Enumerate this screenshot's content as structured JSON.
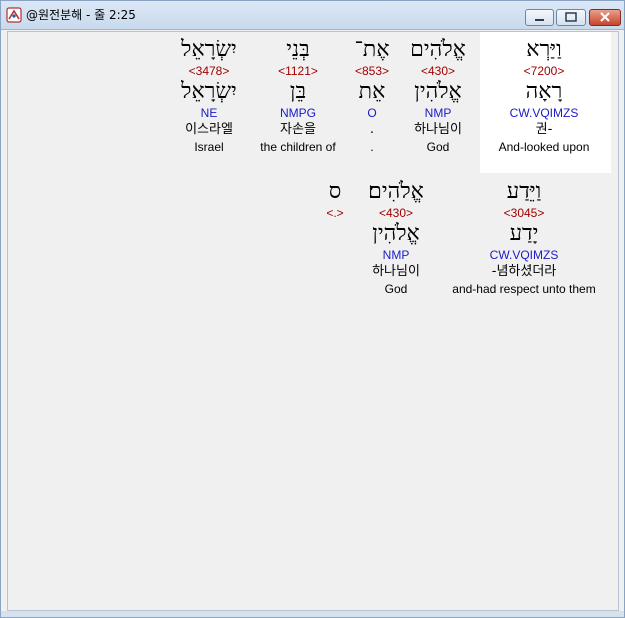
{
  "window": {
    "title": "@원전분해 - 줄 2:25"
  },
  "row1": [
    {
      "heb": "וַיַּרְא",
      "strong": "<7200>",
      "lemma": "רָאָה",
      "morph": "CW.VQIMZS",
      "kor": "권-",
      "eng": "And-looked upon"
    },
    {
      "heb": "אֱלֹהִים",
      "strong": "<430>",
      "lemma": "אֱלֹהִין",
      "morph": "NMP",
      "kor": "하나님이",
      "eng": "God"
    },
    {
      "heb": "אֶת־",
      "strong": "<853>",
      "lemma": "אֵת",
      "morph": "O",
      "kor": ".",
      "eng": "."
    },
    {
      "heb": "בְּנֵי",
      "strong": "<1121>",
      "lemma": "בֵּן",
      "morph": "NMPG",
      "kor": "자손을",
      "eng": "the children of"
    },
    {
      "heb": "יִשְׂרָאֵל",
      "strong": "<3478>",
      "lemma": "יִשְׂרָאֵל",
      "morph": "NE",
      "kor": "이스라엘",
      "eng": "Israel"
    }
  ],
  "row2": [
    {
      "heb": "וַיֵּדַע",
      "strong": "<3045>",
      "lemma": "יָדַע",
      "morph": "CW.VQIMZS",
      "kor": "-념하셨더라",
      "eng": "and-had respect unto them"
    },
    {
      "heb": "אֱלֹהִים׃",
      "strong": "<430>",
      "lemma": "אֱלֹהִין",
      "morph": "NMP",
      "kor": "하나님이",
      "eng": "God"
    },
    {
      "heb": "ס",
      "strong": "<.>"
    }
  ]
}
